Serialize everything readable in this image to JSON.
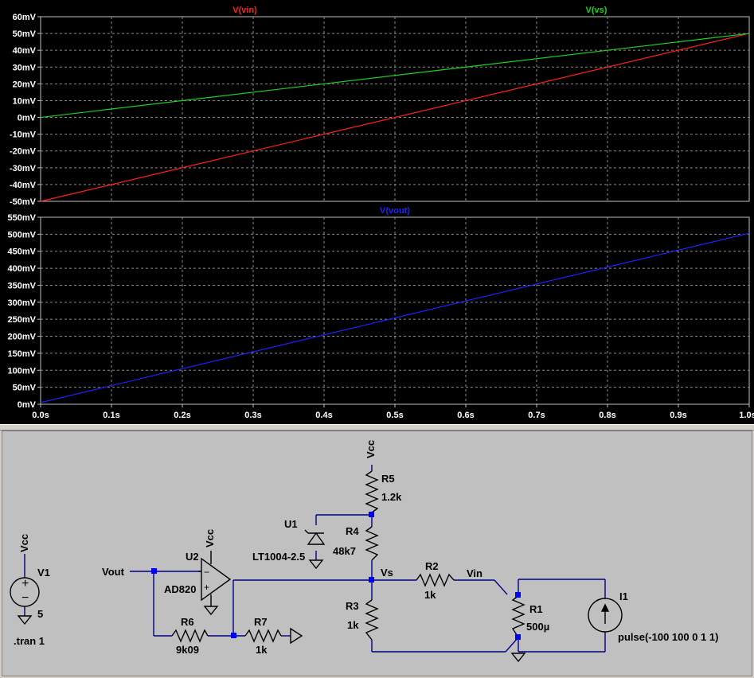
{
  "colors": {
    "background": "#000000",
    "grid": "#8a8a8a",
    "axis_text": "#ffffff",
    "wire": "#000080",
    "junction": "#0000ff",
    "component": "#000000"
  },
  "chart_data": [
    {
      "type": "line",
      "series": [
        {
          "name": "V(vin)",
          "color": "#ff2020",
          "x": [
            0,
            1
          ],
          "y": [
            -50,
            50
          ]
        },
        {
          "name": "V(vs)",
          "color": "#20d020",
          "x": [
            0,
            1
          ],
          "y": [
            0,
            50
          ]
        }
      ],
      "yticks": [
        "60mV",
        "50mV",
        "40mV",
        "30mV",
        "20mV",
        "10mV",
        "0mV",
        "-10mV",
        "-20mV",
        "-30mV",
        "-40mV",
        "-50mV"
      ],
      "ylim": [
        -50,
        60
      ],
      "xlim": [
        0,
        1
      ],
      "grid": true
    },
    {
      "type": "line",
      "series": [
        {
          "name": "V(vout)",
          "color": "#2020ff",
          "x": [
            0,
            1
          ],
          "y": [
            5,
            503
          ]
        }
      ],
      "yticks": [
        "550mV",
        "500mV",
        "450mV",
        "400mV",
        "350mV",
        "300mV",
        "250mV",
        "200mV",
        "150mV",
        "100mV",
        "50mV",
        "0mV"
      ],
      "xticks": [
        "0.0s",
        "0.1s",
        "0.2s",
        "0.3s",
        "0.4s",
        "0.5s",
        "0.6s",
        "0.7s",
        "0.8s",
        "0.9s",
        "1.0s"
      ],
      "ylim": [
        0,
        550
      ],
      "xlim": [
        0,
        1
      ],
      "grid": true
    }
  ],
  "schematic": {
    "labels": {
      "vcc_top": "Vcc",
      "r5": "R5",
      "r5_val": "1.2k",
      "u1": "U1",
      "u1_part": "LT1004-2.5",
      "r4": "R4",
      "r4_val": "48k7",
      "vs": "Vs",
      "r2": "R2",
      "r2_val": "1k",
      "vin": "Vin",
      "r1": "R1",
      "r1_val": "500µ",
      "i1": "I1",
      "i1_val": "pulse(-100 100 0 1 1)",
      "r3": "R3",
      "r3_val": "1k",
      "u2": "U2",
      "u2_part": "AD820",
      "vcc_u2": "Vcc",
      "vout": "Vout",
      "r6": "R6",
      "r6_val": "9k09",
      "r7": "R7",
      "r7_val": "1k",
      "v1": "V1",
      "v1_val": "5",
      "vcc_v1": "Vcc",
      "tran": ".tran 1"
    }
  }
}
